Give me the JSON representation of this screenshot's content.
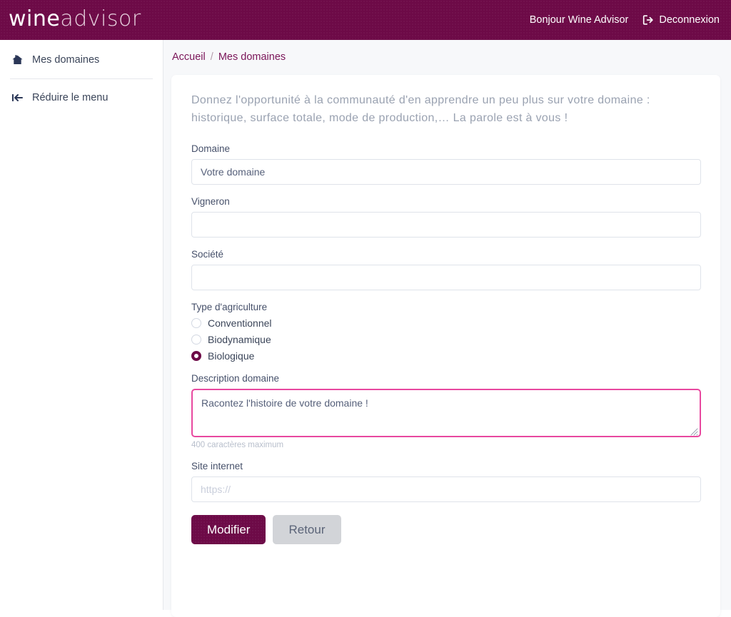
{
  "header": {
    "logo_primary": "wine",
    "logo_secondary": "advisor",
    "greeting": "Bonjour Wine Advisor",
    "logout_label": "Deconnexion",
    "logout_icon": "sign-out-icon",
    "background_color": "#6d0a47"
  },
  "sidebar": {
    "items": [
      {
        "label": "Mes domaines",
        "icon": "home-icon"
      },
      {
        "label": "Réduire le menu",
        "icon": "collapse-menu-icon"
      }
    ]
  },
  "breadcrumb": {
    "home": "Accueil",
    "separator": "/",
    "current": "Mes domaines"
  },
  "main": {
    "intro": "Donnez l'opportunité à la communauté d'en apprendre un peu plus sur votre domaine : historique, surface totale, mode de production,… La parole est à vous !",
    "fields": {
      "domaine": {
        "label": "Domaine",
        "value": "Votre domaine",
        "placeholder": "Votre domaine"
      },
      "vigneron": {
        "label": "Vigneron",
        "value": "",
        "placeholder": ""
      },
      "societe": {
        "label": "Société",
        "value": "",
        "placeholder": ""
      },
      "agriculture": {
        "label": "Type d'agriculture",
        "options": [
          {
            "label": "Conventionnel",
            "selected": false
          },
          {
            "label": "Biodynamique",
            "selected": false
          },
          {
            "label": "Biologique",
            "selected": true
          }
        ],
        "selected_color": "#6d0a47"
      },
      "description": {
        "label": "Description domaine",
        "value": "Racontez l'histoire de votre domaine !",
        "helper": "400 caractères maximum",
        "focus_border_color": "#e8489f",
        "focused": true
      },
      "site": {
        "label": "Site internet",
        "value": "",
        "placeholder": "https://"
      }
    },
    "buttons": {
      "submit": "Modifier",
      "back": "Retour"
    }
  }
}
